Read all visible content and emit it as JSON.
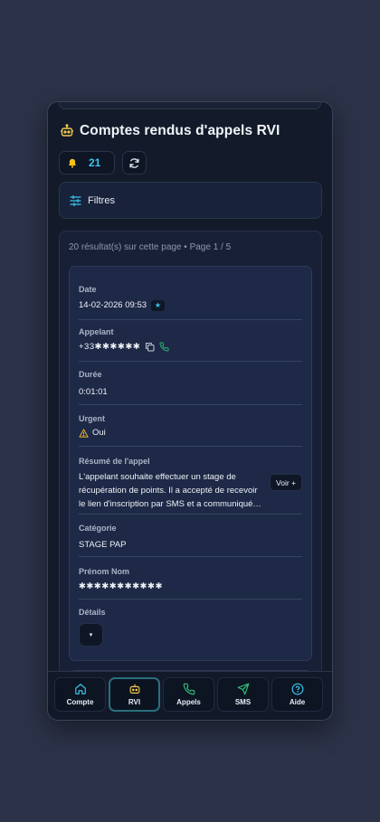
{
  "header": {
    "title": "Comptes rendus d'appels RVI",
    "notification_count": "21"
  },
  "filters": {
    "label": "Filtres"
  },
  "results": {
    "summary": "20 résultat(s) sur cette page • Page 1 / 5"
  },
  "record": {
    "date": {
      "label": "Date",
      "value": "14-02-2026 09:53",
      "badge": "★"
    },
    "caller": {
      "label": "Appelant",
      "value": "+33✱✱✱✱✱✱"
    },
    "duration": {
      "label": "Durée",
      "value": "0:01:01"
    },
    "urgent": {
      "label": "Urgent",
      "value": "Oui"
    },
    "summary": {
      "label": "Résumé de l'appel",
      "value": "L'appelant souhaite effectuer un stage de récupération de points. Il a accepté de recevoir le lien d'inscription par SMS et a communiqué…",
      "more_label": "Voir +"
    },
    "category": {
      "label": "Catégorie",
      "value": "STAGE PAP"
    },
    "name": {
      "label": "Prénom Nom",
      "value": "✱✱✱✱✱✱✱✱✱✱✱"
    },
    "details": {
      "label": "Détails",
      "toggle": "▾"
    }
  },
  "nav": {
    "items": [
      {
        "label": "Compte",
        "icon": "home-icon"
      },
      {
        "label": "RVI",
        "icon": "robot-icon",
        "active": true
      },
      {
        "label": "Appels",
        "icon": "phone-icon"
      },
      {
        "label": "SMS",
        "icon": "send-icon"
      },
      {
        "label": "Aide",
        "icon": "help-icon"
      }
    ]
  },
  "colors": {
    "accent": "#38c6ee",
    "phone_green": "#2fbf7a",
    "warning": "#f2b233",
    "bell": "#f5c21b"
  }
}
